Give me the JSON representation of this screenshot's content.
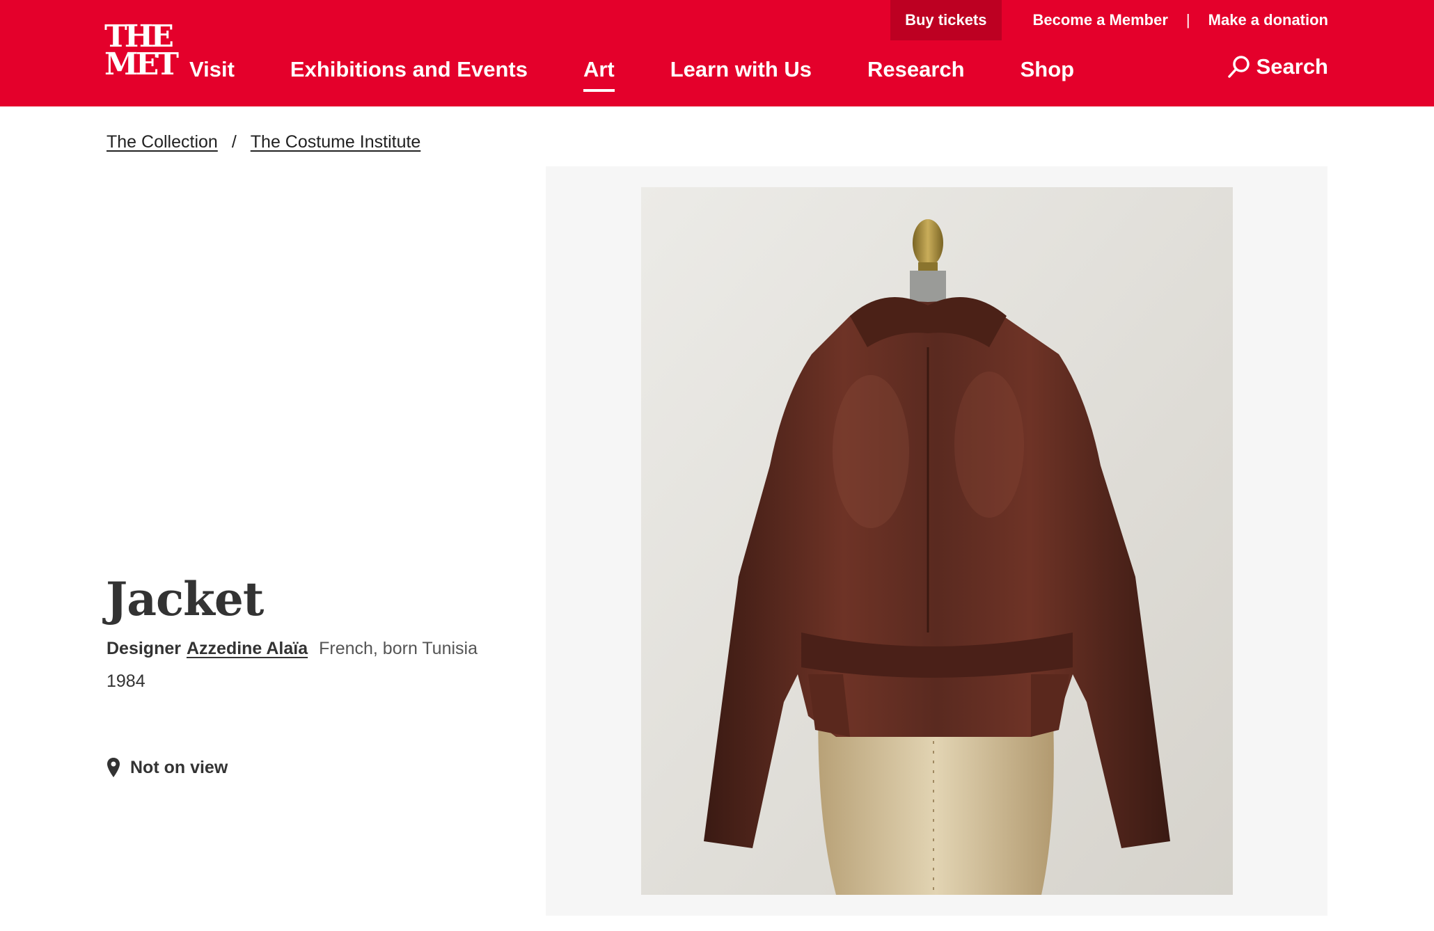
{
  "header": {
    "logo_line1": "THE",
    "logo_line2": "MET",
    "brand_color": "#e4002b",
    "utility": {
      "buy_tickets": "Buy tickets",
      "become_member": "Become a Member",
      "separator": "|",
      "make_donation": "Make a donation"
    },
    "nav": [
      {
        "label": "Visit",
        "active": false
      },
      {
        "label": "Exhibitions and Events",
        "active": false
      },
      {
        "label": "Art",
        "active": true
      },
      {
        "label": "Learn with Us",
        "active": false
      },
      {
        "label": "Research",
        "active": false
      },
      {
        "label": "Shop",
        "active": false
      }
    ],
    "search_label": "Search",
    "search_icon": "magnifier-icon"
  },
  "breadcrumb": {
    "items": [
      "The Collection",
      "The Costume Institute"
    ],
    "separator": "/"
  },
  "object": {
    "title": "Jacket",
    "role": "Designer",
    "designer": "Azzedine Alaïa",
    "nationality": "French, born Tunisia",
    "date": "1984",
    "status": "Not on view",
    "status_icon": "location-pin-icon"
  }
}
